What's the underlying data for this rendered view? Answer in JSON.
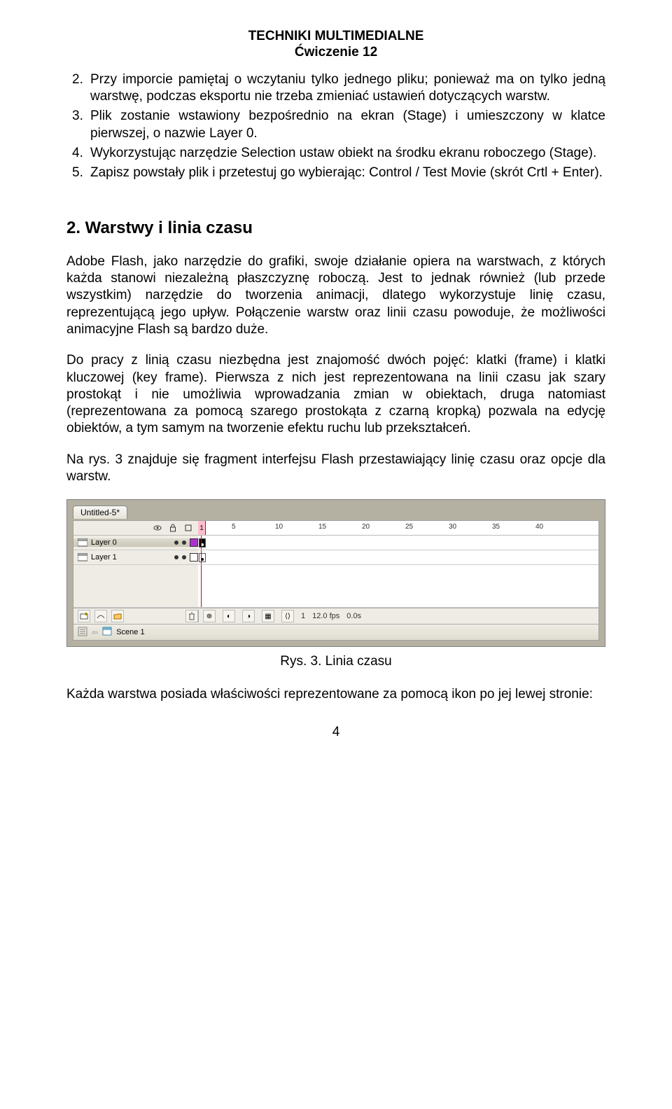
{
  "header": {
    "title": "TECHNIKI MULTIMEDIALNE",
    "subtitle": "Ćwiczenie 12"
  },
  "list": [
    {
      "num": "2.",
      "text": "Przy imporcie pamiętaj o wczytaniu tylko jednego pliku; ponieważ ma on tylko jedną warstwę, podczas eksportu nie trzeba zmieniać ustawień dotyczących warstw."
    },
    {
      "num": "3.",
      "text": "Plik zostanie wstawiony bezpośrednio na ekran (Stage) i umieszczony w klatce pierwszej, o nazwie Layer 0."
    },
    {
      "num": "4.",
      "text": "Wykorzystując narzędzie Selection ustaw obiekt na środku ekranu roboczego (Stage)."
    },
    {
      "num": "5.",
      "text": "Zapisz powstały plik i przetestuj go wybierając: Control / Test Movie (skrót Crtl + Enter)."
    }
  ],
  "section_heading": "2. Warstwy i linia czasu",
  "para1": "Adobe Flash, jako narzędzie do grafiki, swoje działanie opiera na warstwach, z których każda stanowi niezależną płaszczyznę roboczą. Jest to jednak również (lub przede wszystkim) narzędzie do tworzenia animacji, dlatego wykorzystuje linię czasu, reprezentującą jego upływ. Połączenie warstw oraz linii czasu powoduje, że możliwości animacyjne Flash są bardzo duże.",
  "para2": "Do pracy z linią czasu niezbędna jest znajomość dwóch pojęć: klatki (frame) i klatki kluczowej (key frame). Pierwsza z nich jest reprezentowana na linii czasu jak szary prostokąt i nie umożliwia wprowadzania zmian w obiektach, druga natomiast (reprezentowana za pomocą szarego prostokąta z czarną kropką) pozwala na edycję obiektów, a tym samym na tworzenie efektu ruchu lub przekształceń.",
  "para3": "Na rys. 3 znajduje się fragment interfejsu Flash przestawiający linię czasu oraz opcje dla warstw.",
  "figure": {
    "tab_label": "Untitled-5*",
    "ruler_ticks": [
      "1",
      "5",
      "10",
      "15",
      "20",
      "25",
      "30",
      "35",
      "40"
    ],
    "layers": [
      {
        "name": "Layer 0",
        "selected": true,
        "swatch": "#aa33cc"
      },
      {
        "name": "Layer 1",
        "selected": false,
        "swatch": "#ffffff"
      }
    ],
    "footer": {
      "frame": "1",
      "fps": "12.0 fps",
      "time": "0.0s"
    },
    "scene_label": "Scene 1"
  },
  "caption": "Rys. 3. Linia czasu",
  "para4": "Każda warstwa posiada właściwości reprezentowane za pomocą ikon po jej lewej stronie:",
  "page_number": "4"
}
